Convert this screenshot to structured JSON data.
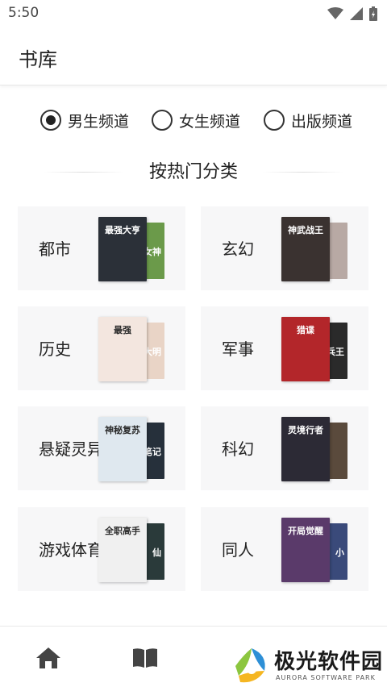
{
  "status": {
    "time": "5:50"
  },
  "header": {
    "title": "书库"
  },
  "channels": [
    {
      "label": "男生频道",
      "selected": true
    },
    {
      "label": "女生频道",
      "selected": false
    },
    {
      "label": "出版频道",
      "selected": false
    }
  ],
  "section": {
    "title": "按热门分类"
  },
  "categories": [
    {
      "label": "都市",
      "front_title": "最强大亨",
      "back_title": "我的女神",
      "front_color": "#2b3038",
      "back_color": "#6b9a4a"
    },
    {
      "label": "玄幻",
      "front_title": "神武战王",
      "back_title": "",
      "front_color": "#3a3230",
      "back_color": "#b8a9a4"
    },
    {
      "label": "历史",
      "front_title": "最强",
      "back_title": "大明",
      "front_color": "#f3e6df",
      "back_color": "#e9d4c6"
    },
    {
      "label": "军事",
      "front_title": "猎谍",
      "back_title": "兵王",
      "front_color": "#b3262a",
      "back_color": "#2a2a2a"
    },
    {
      "label": "悬疑灵异",
      "front_title": "神秘复苏",
      "back_title": "盗墓笔记",
      "front_color": "#dfe8ef",
      "back_color": "#26303b"
    },
    {
      "label": "科幻",
      "front_title": "灵境行者",
      "back_title": "",
      "front_color": "#2c2a35",
      "back_color": "#5a4a3c"
    },
    {
      "label": "游戏体育",
      "front_title": "全职高手",
      "back_title": "仙",
      "front_color": "#f0f0f0",
      "back_color": "#2a3a3a"
    },
    {
      "label": "同人",
      "front_title": "开局觉醒",
      "back_title": "小",
      "front_color": "#5a3a6a",
      "back_color": "#3a4a7a"
    }
  ],
  "bottom_nav": [
    {
      "icon": "home-icon"
    },
    {
      "icon": "book-icon"
    }
  ],
  "watermark": {
    "text": "极光软件园",
    "sub": "AURORA SOFTWARE PARK"
  }
}
